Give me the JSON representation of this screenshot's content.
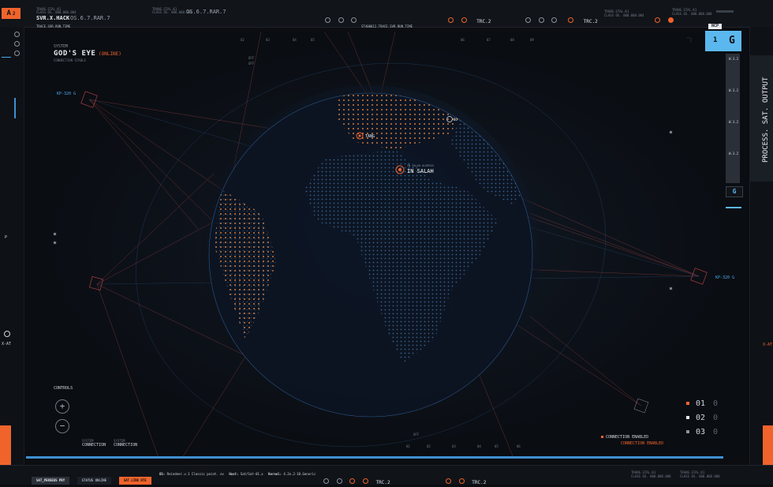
{
  "header": {
    "badge_a": "A",
    "badge_num": "2",
    "title": "SVR.X.HACK",
    "version": "OS.6.7.RAR.7",
    "version2": "OS.6.7.RAR.7",
    "track": "TRACE.SVR.RUN.TIME",
    "track2": "ST400012.TRACE.SVR.RUN.TIME",
    "trc_label": "TRC.2",
    "trc_label2": "TRC.2",
    "micro1": "TRANS.STAL.K1",
    "micro2": "CLASS OS. 000.000.004",
    "micro3": "CLASS OS. 000.000.000"
  },
  "system": {
    "label": "SYSTEM",
    "name": "GOD'S EYE",
    "status": "(ONLINE)",
    "connection": "CONNECTION STABLE"
  },
  "grid_numbers": [
    "02",
    "03",
    "04",
    "05",
    "06",
    "07",
    "08",
    "09"
  ],
  "grid_numbers_bottom": [
    "01",
    "02",
    "03",
    "04",
    "05",
    "06"
  ],
  "markers": {
    "sat_left": "KP-320 G",
    "sat_right": "KP-320 G",
    "tang": "TANG",
    "in_salah": "IN SALAH",
    "in_salah_sub": "IN SALAH ALGERIA",
    "bo": "BO",
    "off1": "OFF",
    "off2": "OFF",
    "off3": "OFF"
  },
  "right_panel": {
    "ncp": "NCP",
    "one": "1",
    "g": "G",
    "process": "PROCESS. SAT. OUTPUT",
    "g_small": "G",
    "rows": [
      "W.3.2",
      "W.3.2",
      "W.3.2",
      "W.3.2",
      "W.3.2"
    ]
  },
  "controls": {
    "label": "CONTROLS",
    "plus": "+",
    "minus": "−"
  },
  "system_conn": [
    {
      "label": "SYSTEM",
      "value": "CONNECTION"
    },
    {
      "label": "SYSTEM",
      "value": "CONNECTION"
    }
  ],
  "legend": [
    {
      "num": "01",
      "count": "0",
      "color": "#f0642c"
    },
    {
      "num": "02",
      "count": "0",
      "color": "#e6e9ee"
    },
    {
      "num": "03",
      "count": "0",
      "color": "#8b939e"
    }
  ],
  "connection_enabled": "CONNECTION ENABLED",
  "connection_enabled2": "CONNECTION ENABLED",
  "left_rail": {
    "p": "P",
    "xat": "X-AT"
  },
  "right_rail": {
    "xat": "X-AT"
  },
  "footer": {
    "pill1": "SAT_PERSEUS PRY",
    "pill2": "STATUS ONLINE",
    "pill3": "SAT.LINK RTE",
    "os": "OS:",
    "os_val": "Reindeer.v.1 Classic point. ov",
    "host": "Host:",
    "host_val": "Sat/Sat-01.x",
    "kernel": "Kernel:",
    "kernel_val": "4.2e.2-10.Generic",
    "trc": "TRC.2",
    "trc2": "TRC.2"
  },
  "colors": {
    "accent_orange": "#f0642c",
    "accent_blue": "#4aa8e8",
    "panel_blue": "#5bb8ee"
  }
}
